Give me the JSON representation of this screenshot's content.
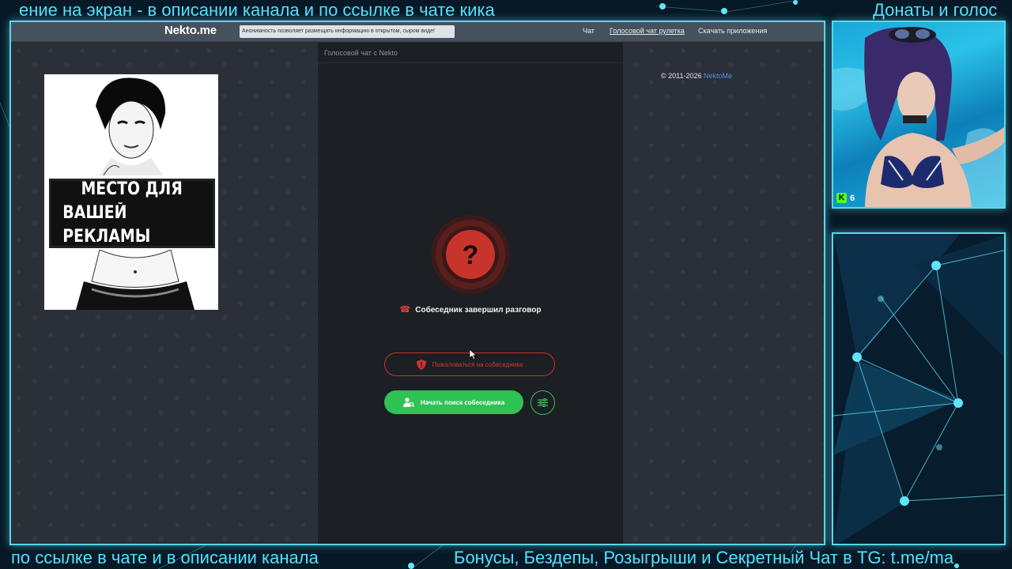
{
  "overlay": {
    "ticker_top_left": "ение на экран - в описании канала и по ссылке в чате кика",
    "ticker_top_right": "Донаты и голос",
    "ticker_bottom_left": "по ссылке в чате и в описании канала",
    "ticker_bottom_right": "Бонусы, Бездепы, Розыгрыши и Секретный Чат в TG: t.me/ma",
    "accent_color": "#4fe3ff"
  },
  "site": {
    "logo": "Nekto.me",
    "notice": "Анонимность позволяет размещать информацию в открытом, сыром виде!",
    "nav": {
      "chat": "Чат",
      "voice_roulette": "Голосовой чат рулетка",
      "download_apps": "Скачать приложения"
    },
    "copyright_prefix": "© 2011-2026 ",
    "copyright_link": "NektoMe"
  },
  "ad": {
    "line1": "МЕСТО ДЛЯ",
    "line2": "ВАШЕЙ РЕКЛАМЫ"
  },
  "chat": {
    "panel_title": "Голосовой чат с Nekto",
    "status_icon": "question-icon",
    "status_text": "Собеседник завершил разговор",
    "report_label": "Пожаловаться на собеседника",
    "search_label": "Начать поиск собеседника",
    "colors": {
      "danger": "#c8342c",
      "success": "#2fc255"
    }
  },
  "webcam": {
    "viewer_count": "6",
    "platform_badge": "K"
  }
}
